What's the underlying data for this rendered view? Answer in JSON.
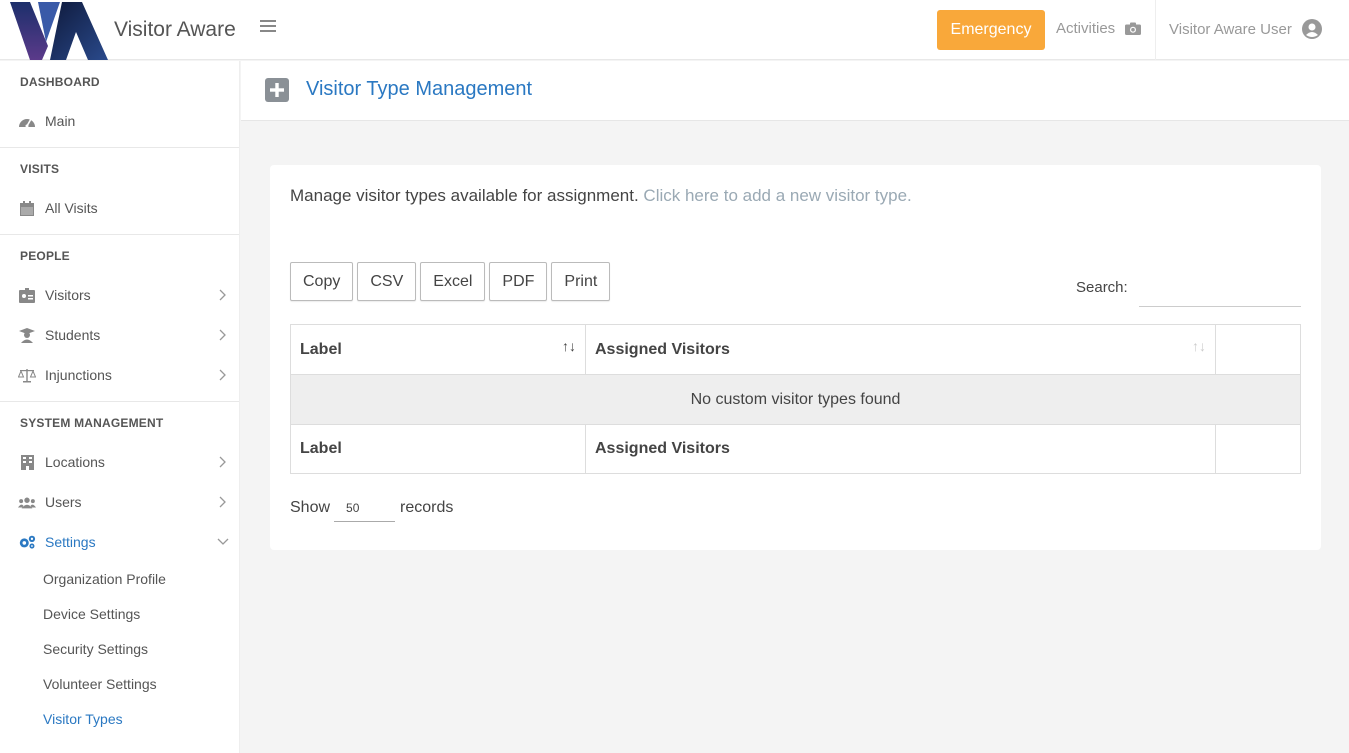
{
  "header": {
    "brand": "Visitor Aware",
    "emergency_label": "Emergency",
    "activities_label": "Activities",
    "user_name": "Visitor Aware User"
  },
  "sidebar": {
    "dashboard_title": "DASHBOARD",
    "main": "Main",
    "visits_title": "VISITS",
    "all_visits": "All Visits",
    "people_title": "PEOPLE",
    "visitors": "Visitors",
    "students": "Students",
    "injunctions": "Injunctions",
    "system_title": "SYSTEM MANAGEMENT",
    "locations": "Locations",
    "users": "Users",
    "settings": "Settings",
    "sub": {
      "org_profile": "Organization Profile",
      "device": "Device Settings",
      "security": "Security Settings",
      "volunteer": "Volunteer Settings",
      "visitor_types": "Visitor Types"
    }
  },
  "page": {
    "title": "Visitor Type Management",
    "intro": "Manage visitor types available for assignment.",
    "add_link": "Click here to add a new visitor type.",
    "buttons": {
      "copy": "Copy",
      "csv": "CSV",
      "excel": "Excel",
      "pdf": "PDF",
      "print": "Print"
    },
    "search_label": "Search:",
    "table": {
      "col_label": "Label",
      "col_assigned": "Assigned Visitors",
      "empty": "No custom visitor types found"
    },
    "show": "Show",
    "records_value": "50",
    "records": "records"
  },
  "colors": {
    "accent": "#2a78c2",
    "emergency": "#f9a83a"
  }
}
